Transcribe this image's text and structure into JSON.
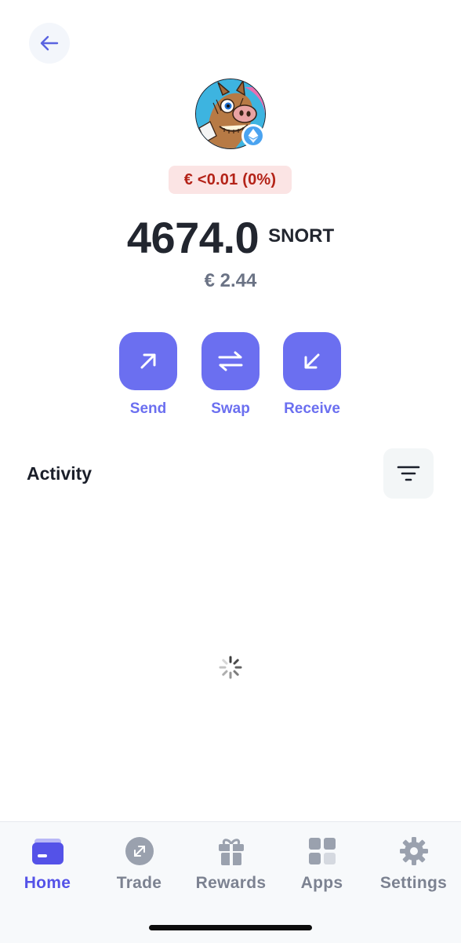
{
  "header": {
    "back_icon": "arrow-left-icon"
  },
  "token": {
    "avatar_icon": "token-avatar-image",
    "chain_icon": "ethereum-icon",
    "change_text": "€ <0.01 (0%)",
    "amount": "4674.0",
    "symbol": "SNORT",
    "fiat_value": "€ 2.44"
  },
  "actions": [
    {
      "label": "Send",
      "icon": "arrow-up-right-icon"
    },
    {
      "label": "Swap",
      "icon": "swap-arrows-icon"
    },
    {
      "label": "Receive",
      "icon": "arrow-down-left-icon"
    }
  ],
  "activity": {
    "title": "Activity",
    "filter_icon": "filter-icon",
    "loading_icon": "loading-spinner-icon"
  },
  "tabbar": {
    "items": [
      {
        "label": "Home",
        "icon": "wallet-icon",
        "active": true
      },
      {
        "label": "Trade",
        "icon": "trade-icon",
        "active": false
      },
      {
        "label": "Rewards",
        "icon": "gift-icon",
        "active": false
      },
      {
        "label": "Apps",
        "icon": "apps-grid-icon",
        "active": false
      },
      {
        "label": "Settings",
        "icon": "gear-icon",
        "active": false
      }
    ]
  },
  "colors": {
    "accent": "#6b6ff0",
    "tab_active": "#5452e8",
    "negative_change_text": "#b42318",
    "negative_change_bg": "#fbe4e4"
  }
}
